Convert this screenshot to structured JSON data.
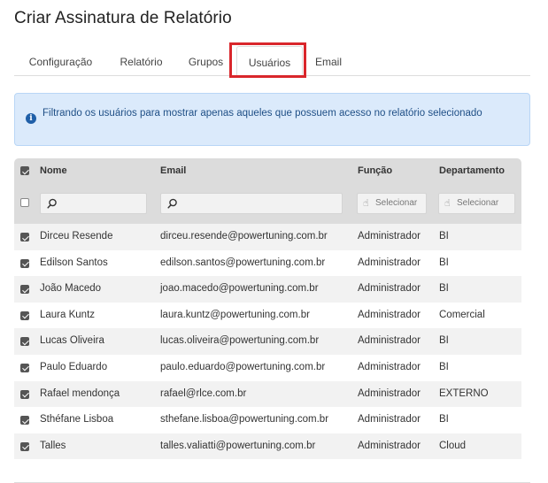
{
  "page_title": "Criar Assinatura de Relatório",
  "tabs": [
    {
      "label": "Configuração",
      "active": false
    },
    {
      "label": "Relatório",
      "active": false
    },
    {
      "label": "Grupos",
      "active": false
    },
    {
      "label": "Usuários",
      "active": true
    },
    {
      "label": "Email",
      "active": false
    }
  ],
  "info": {
    "icon": "info-icon",
    "text": "Filtrando os usuários para mostrar apenas aqueles que possuem acesso no relatório selecionado"
  },
  "grid": {
    "columns": [
      "Nome",
      "Email",
      "Função",
      "Departamento"
    ],
    "select_label": "Selecionar",
    "header_checked": true,
    "filter_row_checked": false,
    "rows": [
      {
        "checked": true,
        "name": "Dirceu Resende",
        "email": "dirceu.resende@powertuning.com.br",
        "role": "Administrador",
        "dept": "BI"
      },
      {
        "checked": true,
        "name": "Edilson Santos",
        "email": "edilson.santos@powertuning.com.br",
        "role": "Administrador",
        "dept": "BI"
      },
      {
        "checked": true,
        "name": "João Macedo",
        "email": "joao.macedo@powertuning.com.br",
        "role": "Administrador",
        "dept": "BI"
      },
      {
        "checked": true,
        "name": "Laura Kuntz",
        "email": "laura.kuntz@powertuning.com.br",
        "role": "Administrador",
        "dept": "Comercial"
      },
      {
        "checked": true,
        "name": "Lucas Oliveira",
        "email": "lucas.oliveira@powertuning.com.br",
        "role": "Administrador",
        "dept": "BI"
      },
      {
        "checked": true,
        "name": "Paulo Eduardo",
        "email": "paulo.eduardo@powertuning.com.br",
        "role": "Administrador",
        "dept": "BI"
      },
      {
        "checked": true,
        "name": "Rafael mendonça",
        "email": "rafael@rlce.com.br",
        "role": "Administrador",
        "dept": "EXTERNO"
      },
      {
        "checked": true,
        "name": "Sthéfane Lisboa",
        "email": "sthefane.lisboa@powertuning.com.br",
        "role": "Administrador",
        "dept": "BI"
      },
      {
        "checked": true,
        "name": "Talles",
        "email": "talles.valiatti@powertuning.com.br",
        "role": "Administrador",
        "dept": "Cloud"
      }
    ]
  }
}
